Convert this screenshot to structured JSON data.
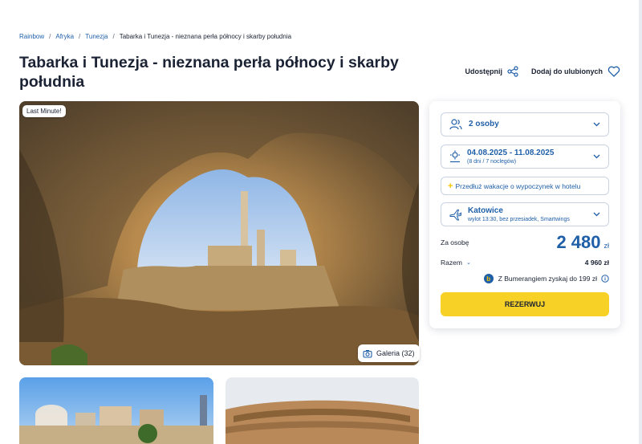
{
  "breadcrumb": {
    "items": [
      "Rainbow",
      "Afryka",
      "Tunezja"
    ],
    "current": "Tabarka i Tunezja - nieznana perła północy i skarby południa"
  },
  "page": {
    "title": "Tabarka i Tunezja - nieznana perła północy i skarby południa"
  },
  "actions": {
    "share_label": "Udostępnij",
    "favorite_label": "Dodaj do ulubionych"
  },
  "hero": {
    "badge": "Last Minute!",
    "gallery_label": "Galeria (32)"
  },
  "booking": {
    "persons": "2 osoby",
    "dates": "04.08.2025 - 11.08.2025",
    "dates_sub": "(8 dni / 7 noclegów)",
    "extend_label": "Przedłuż wakacje o wypoczynek w hotelu",
    "departure_city": "Katowice",
    "departure_sub": "wylot 13:30, bez przesiadek, Smartwings",
    "per_person_label": "Za osobę",
    "price": "2 480",
    "currency": "zł",
    "total_label": "Razem",
    "total_value": "4 960 zł",
    "bumerang_text": "Z Bumerangiem zyskaj do 199 zł",
    "reserve_label": "REZERWUJ"
  },
  "colors": {
    "brand_blue": "#1f5fa8",
    "accent_yellow": "#f7d126",
    "text_dark": "#1a2233"
  }
}
